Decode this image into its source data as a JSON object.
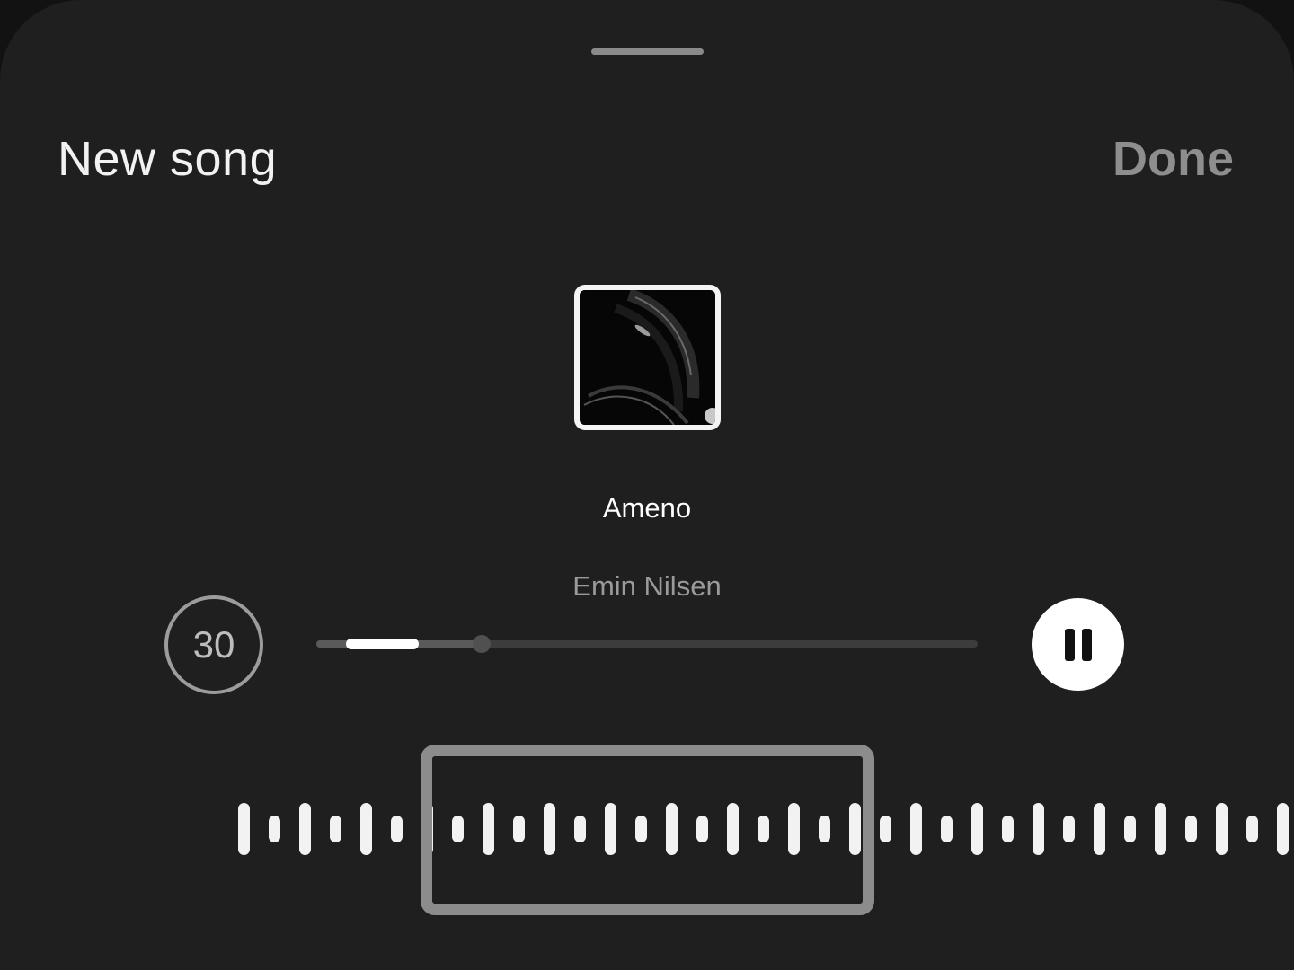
{
  "header": {
    "title": "New song",
    "done_label": "Done"
  },
  "track": {
    "title": "Ameno",
    "artist": "Emin Nilsen"
  },
  "controls": {
    "duration_label": "30",
    "progress": {
      "played_fraction": 0.25,
      "selected_start_fraction": 0.045,
      "selected_end_fraction": 0.155
    },
    "pause_icon": "pause-icon"
  },
  "waveform": {
    "pattern": [
      "tall",
      "short",
      "tall",
      "short"
    ],
    "bar_count": 35,
    "selection_first_bar": 4,
    "selection_last_bar": 19
  },
  "colors": {
    "background": "#1f1f1f",
    "accent": "#ffffff",
    "muted": "#8e8e8e"
  }
}
